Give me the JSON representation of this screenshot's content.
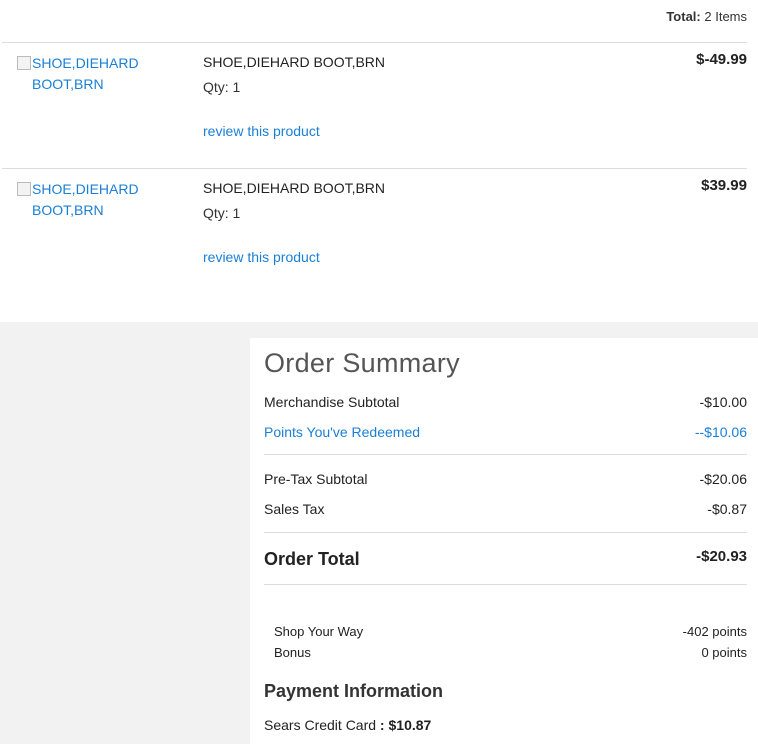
{
  "cart": {
    "total_label": "Total:",
    "total_value": "2 Items",
    "items": [
      {
        "image_alt": "SHOE,DIEHARD BOOT,BRN",
        "name": "SHOE,DIEHARD BOOT,BRN",
        "qty": "Qty: 1",
        "review": "review this product",
        "price": "$-49.99"
      },
      {
        "image_alt": "SHOE,DIEHARD BOOT,BRN",
        "name": "SHOE,DIEHARD BOOT,BRN",
        "qty": "Qty: 1",
        "review": "review this product",
        "price": "$39.99"
      }
    ]
  },
  "summary": {
    "title": "Order Summary",
    "merch_label": "Merchandise Subtotal",
    "merch_value": "-$10.00",
    "points_label": "Points You've Redeemed",
    "points_value": "--$10.06",
    "pretax_label": "Pre-Tax Subtotal",
    "pretax_value": "-$20.06",
    "tax_label": "Sales Tax",
    "tax_value": "-$0.87",
    "total_label": "Order Total",
    "total_value": "-$20.93",
    "syw_label": "Shop Your Way",
    "syw_value": "-402 points",
    "bonus_label": "Bonus",
    "bonus_value": "0 points"
  },
  "payment": {
    "title": "Payment Information",
    "method_label": "Sears Credit Card",
    "sep": " : ",
    "amount": "$10.87"
  },
  "colors": {
    "link": "#1a7fd6",
    "band": "#f2f2f2"
  }
}
